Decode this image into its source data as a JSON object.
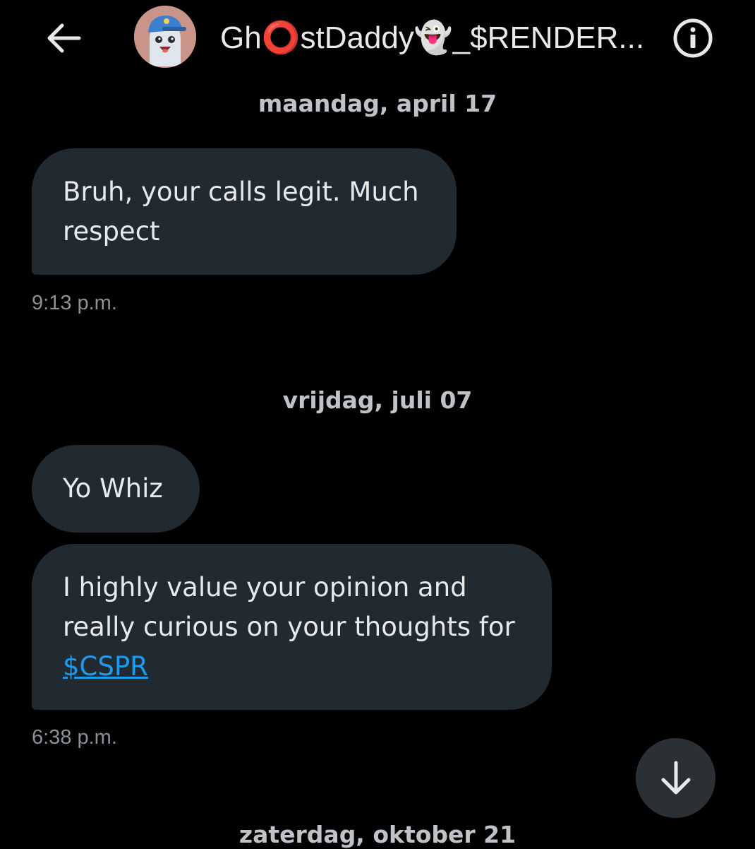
{
  "header": {
    "back_icon": "arrow-left-icon",
    "avatar_alt": "GhOstDaddy avatar",
    "title": "Gh⭕stDaddy👻_$RENDER...",
    "info_icon": "info-circle-icon"
  },
  "conversation": {
    "groups": [
      {
        "date": "maandag, april 17",
        "messages": [
          {
            "text": "Bruh, your calls legit. Much respect"
          }
        ],
        "time": "9:13 p.m."
      },
      {
        "date": "vrijdag, juli 07",
        "messages": [
          {
            "text": "Yo Whiz"
          },
          {
            "text": "I highly value your opinion and really curious on your thoughts for",
            "link": "$CSPR"
          }
        ],
        "time": "6:38 p.m."
      },
      {
        "date": "zaterdag, oktober 21"
      }
    ]
  },
  "scroll_button_icon": "arrow-down-icon",
  "colors": {
    "background": "#000000",
    "bubble": "#222a31",
    "text": "#e7e9ea",
    "muted": "#8b9095",
    "link": "#1d9bf0"
  }
}
